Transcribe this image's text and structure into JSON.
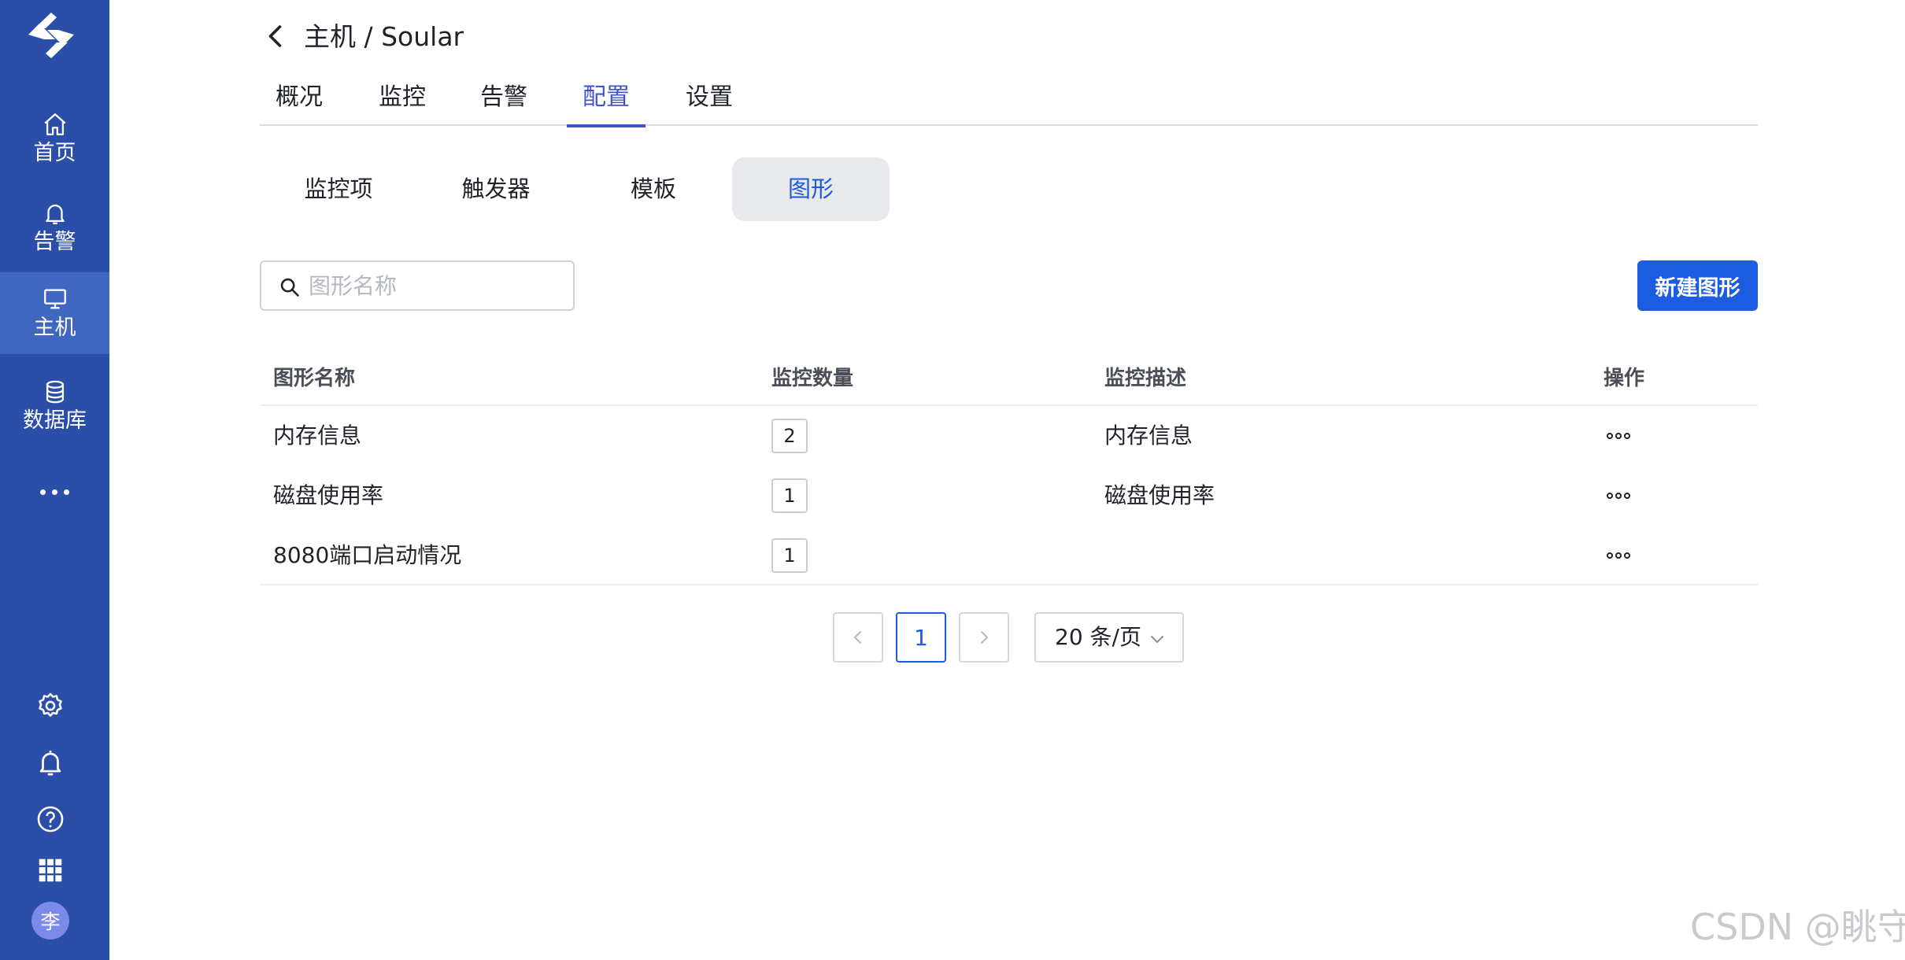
{
  "sidebar": {
    "items": [
      {
        "label": "首页",
        "icon": "home-icon"
      },
      {
        "label": "告警",
        "icon": "bell-icon"
      },
      {
        "label": "主机",
        "icon": "monitor-icon",
        "active": true
      },
      {
        "label": "数据库",
        "icon": "database-icon"
      }
    ],
    "bottom_icons": [
      "settings-icon",
      "notification-icon",
      "help-icon",
      "apps-grid-icon"
    ],
    "avatar_initial": "李",
    "background_color": "#2b4fa8",
    "active_color": "#4067bf"
  },
  "header": {
    "breadcrumb": "主机 / Soular",
    "tabs": [
      {
        "label": "概况"
      },
      {
        "label": "监控"
      },
      {
        "label": "告警"
      },
      {
        "label": "配置",
        "active": true
      },
      {
        "label": "设置"
      }
    ]
  },
  "subtabs": [
    {
      "label": "监控项"
    },
    {
      "label": "触发器"
    },
    {
      "label": "模板"
    },
    {
      "label": "图形",
      "active": true
    }
  ],
  "toolbar": {
    "search_placeholder": "图形名称",
    "search_value": "",
    "create_label": "新建图形",
    "primary_color": "#1c5ce0"
  },
  "table": {
    "columns": [
      "图形名称",
      "监控数量",
      "监控描述",
      "操作"
    ],
    "rows": [
      {
        "name": "内存信息",
        "count": "2",
        "description": "内存信息"
      },
      {
        "name": "磁盘使用率",
        "count": "1",
        "description": "磁盘使用率"
      },
      {
        "name": "8080端口启动情况",
        "count": "1",
        "description": ""
      }
    ]
  },
  "pagination": {
    "current_page": "1",
    "page_size_label": "20 条/页"
  },
  "watermark": "CSDN @眺守"
}
